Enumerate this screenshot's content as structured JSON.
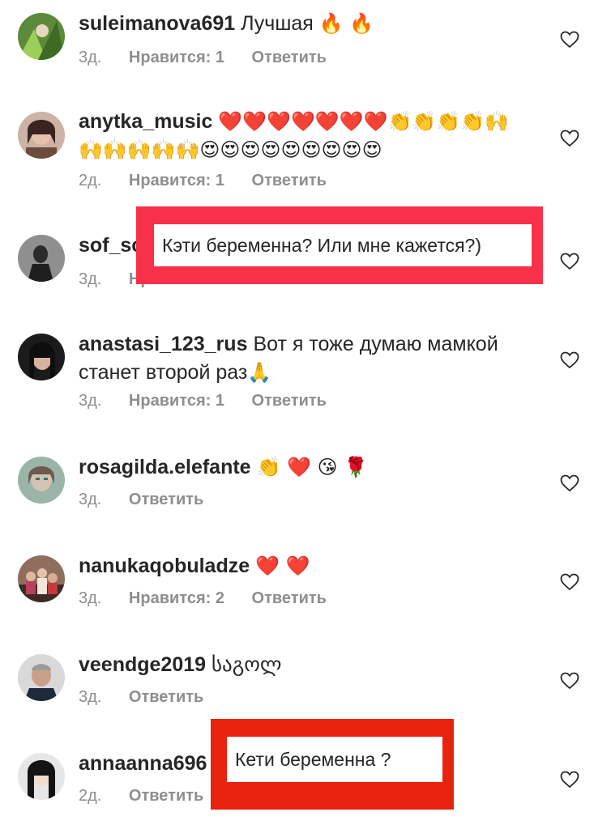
{
  "labels": {
    "likes": "Нравится:",
    "reply": "Ответить"
  },
  "colors": {
    "callout_1": "#f8304a",
    "callout_2": "#e8230e",
    "meta": "#8e8e8e",
    "heart_red": "#ed1c24"
  },
  "comments": [
    {
      "username": "suleimanova691",
      "text": "Лучшая",
      "emoji": "🔥 🔥",
      "time": "3д.",
      "likes": "1"
    },
    {
      "username": "anytka_music",
      "text": "",
      "emoji": "❤️❤️❤️❤️❤️❤️❤️👏👏👏👏🙌🙌🙌🙌🙌🙌😍😍😍😍😍😍😍😍😍",
      "time": "2д.",
      "likes": "1"
    },
    {
      "username": "sof_sc",
      "text": "",
      "emoji": "",
      "time": "3д.",
      "likes": ""
    },
    {
      "username": "anastasi_123_rus",
      "text": "Вот я тоже думаю мамкой станет второй раз",
      "emoji": "🙏",
      "time": "3д.",
      "likes": "1"
    },
    {
      "username": "rosagilda.elefante",
      "text": "",
      "emoji": "👏 ❤️ 😘 🌹",
      "time": "3д.",
      "likes": ""
    },
    {
      "username": "nanukaqobuladze",
      "text": "",
      "emoji": "❤️ ❤️",
      "time": "3д.",
      "likes": "2"
    },
    {
      "username": "veendge2019",
      "text": "საგოლ",
      "emoji": "",
      "time": "3д.",
      "likes": ""
    },
    {
      "username": "annaanna696",
      "text": "",
      "emoji": "",
      "time": "2д.",
      "likes": ""
    }
  ],
  "callouts": [
    {
      "text": "Кэти беременна? Или мне кажется?)"
    },
    {
      "text": "Кети беременна ?"
    }
  ]
}
